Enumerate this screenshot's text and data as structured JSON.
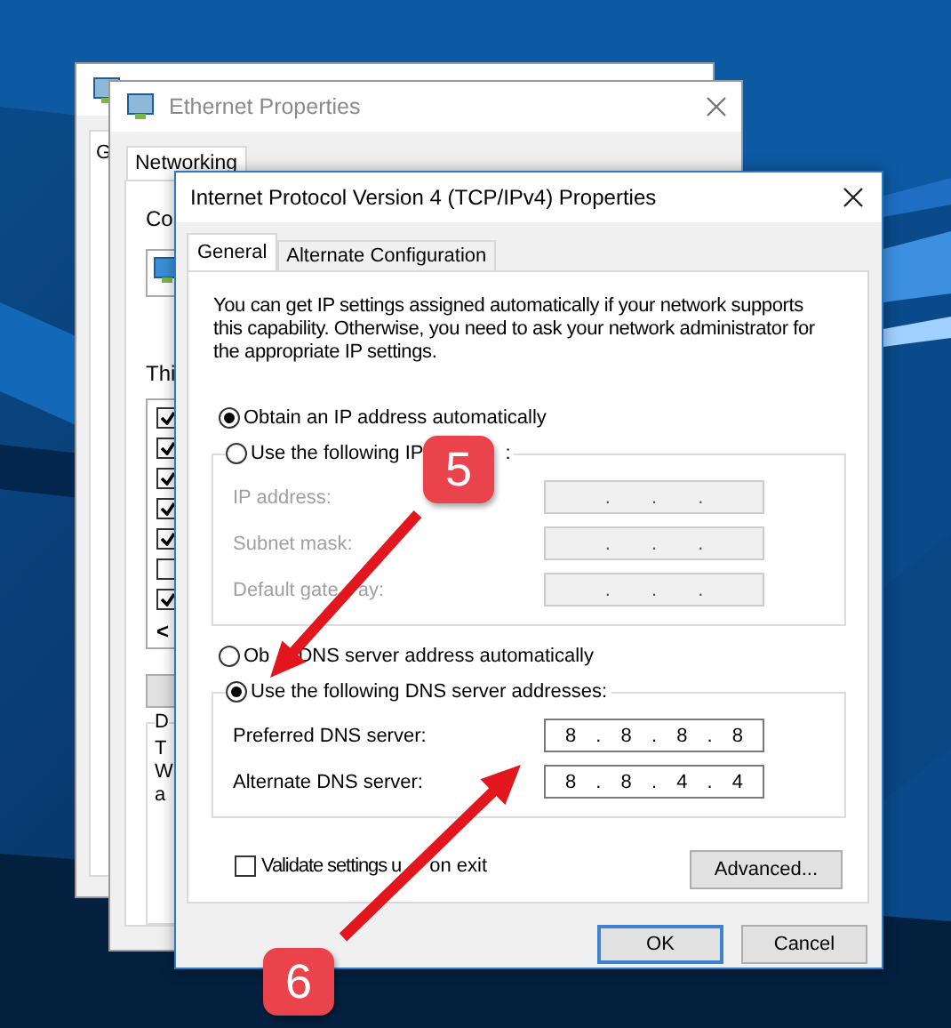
{
  "back_window": {
    "tab_fragment": "G"
  },
  "ethernet_window": {
    "title": "Ethernet Properties",
    "tabs": [
      {
        "label": "Networking",
        "selected": true
      }
    ],
    "connect_fragment": "Co",
    "list_fragment": "Thi",
    "components": [
      {
        "checked": true
      },
      {
        "checked": true
      },
      {
        "checked": true
      },
      {
        "checked": true
      },
      {
        "checked": true
      },
      {
        "checked": false
      },
      {
        "checked": true
      }
    ],
    "scroll_arrow": "<",
    "group_fragments": [
      "D",
      "T",
      "W",
      "a"
    ]
  },
  "dialog": {
    "title": "Internet Protocol Version 4 (TCP/IPv4) Properties",
    "tabs": [
      {
        "label": "General",
        "selected": true
      },
      {
        "label": "Alternate Configuration",
        "selected": false
      }
    ],
    "description": "You can get IP settings assigned automatically if your network supports this capability. Otherwise, you need to ask your network administrator for the appropriate IP settings.",
    "ip_mode": [
      {
        "label": "Obtain an IP address automatically",
        "selected": true
      },
      {
        "label": "Use the following IP",
        "label_end": ":",
        "selected": false
      }
    ],
    "ip_fields": [
      {
        "label": "IP address:",
        "value": ". . .",
        "disabled": true
      },
      {
        "label": "Subnet mask:",
        "value": ". . .",
        "disabled": true
      },
      {
        "label": "Default gate",
        "label_end": "ay:",
        "value": ". . .",
        "disabled": true
      }
    ],
    "dns_mode": [
      {
        "label": "Ob",
        "label_end": "DNS server address automatically",
        "selected": false
      },
      {
        "label": "Use the following DNS server addresses:",
        "selected": true
      }
    ],
    "dns_fields": [
      {
        "label": "Preferred DNS server:",
        "value": "8 . 8 . 8 . 8",
        "disabled": false
      },
      {
        "label": "Alternate DNS server:",
        "value": "8 . 8 . 4 . 4",
        "disabled": false
      }
    ],
    "validate": {
      "label": "Validate settings u",
      "label_end": "on exit",
      "checked": false
    },
    "advanced_button": "Advanced...",
    "buttons": [
      {
        "label": "OK",
        "default": true
      },
      {
        "label": "Cancel",
        "default": false
      }
    ]
  },
  "annotations": [
    {
      "label": "5"
    },
    {
      "label": "6"
    }
  ]
}
